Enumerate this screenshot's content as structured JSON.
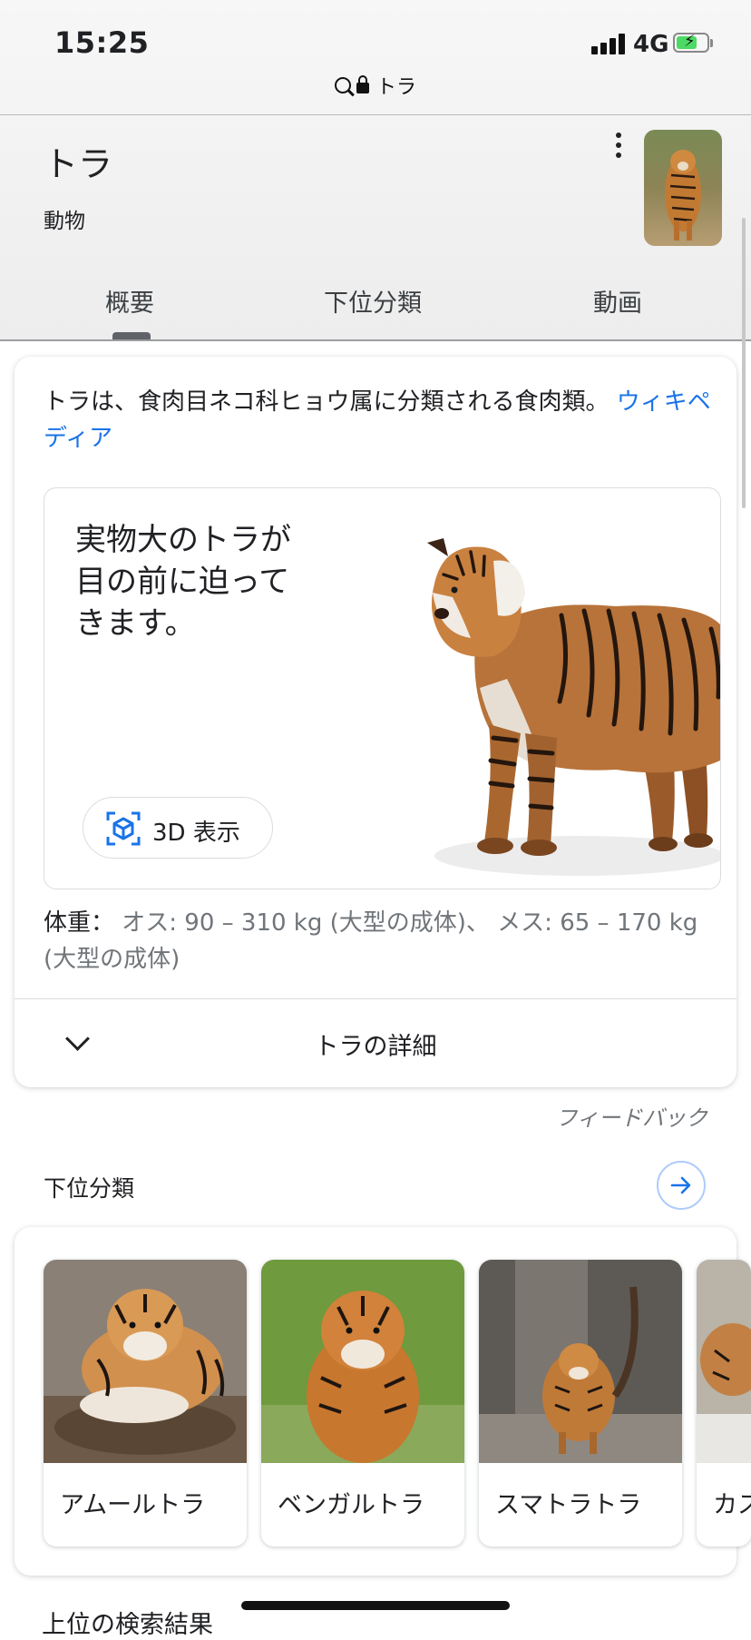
{
  "status_bar": {
    "time": "15:25",
    "network": "4G"
  },
  "url_bar": {
    "text": "トラ"
  },
  "entity": {
    "title": "トラ",
    "subtitle": "動物"
  },
  "tabs": [
    {
      "label": "概要",
      "active": true
    },
    {
      "label": "下位分類",
      "active": false
    },
    {
      "label": "動画",
      "active": false
    }
  ],
  "overview": {
    "description": "トラは、食肉目ネコ科ヒョウ属に分類される食肉類。",
    "source_link": "ウィキペディア",
    "ar_promo": {
      "text": "実物大のトラが目の前に迫ってきます。",
      "button_label": "3D 表示"
    },
    "weight": {
      "key": "体重：",
      "value": "オス: 90 – 310 kg (大型の成体)、 メス: 65 – 170 kg (大型の成体)"
    },
    "more_label": "トラの詳細"
  },
  "feedback_label": "フィードバック",
  "subclass": {
    "header": "下位分類",
    "items": [
      {
        "label": "アムールトラ"
      },
      {
        "label": "ベンガルトラ"
      },
      {
        "label": "スマトラトラ"
      },
      {
        "label": "カス"
      }
    ]
  },
  "bottom_text": "上位の検索結果",
  "colors": {
    "link": "#1a73e8",
    "text": "#202124",
    "secondary": "#70757a",
    "battery": "#4cd964"
  }
}
